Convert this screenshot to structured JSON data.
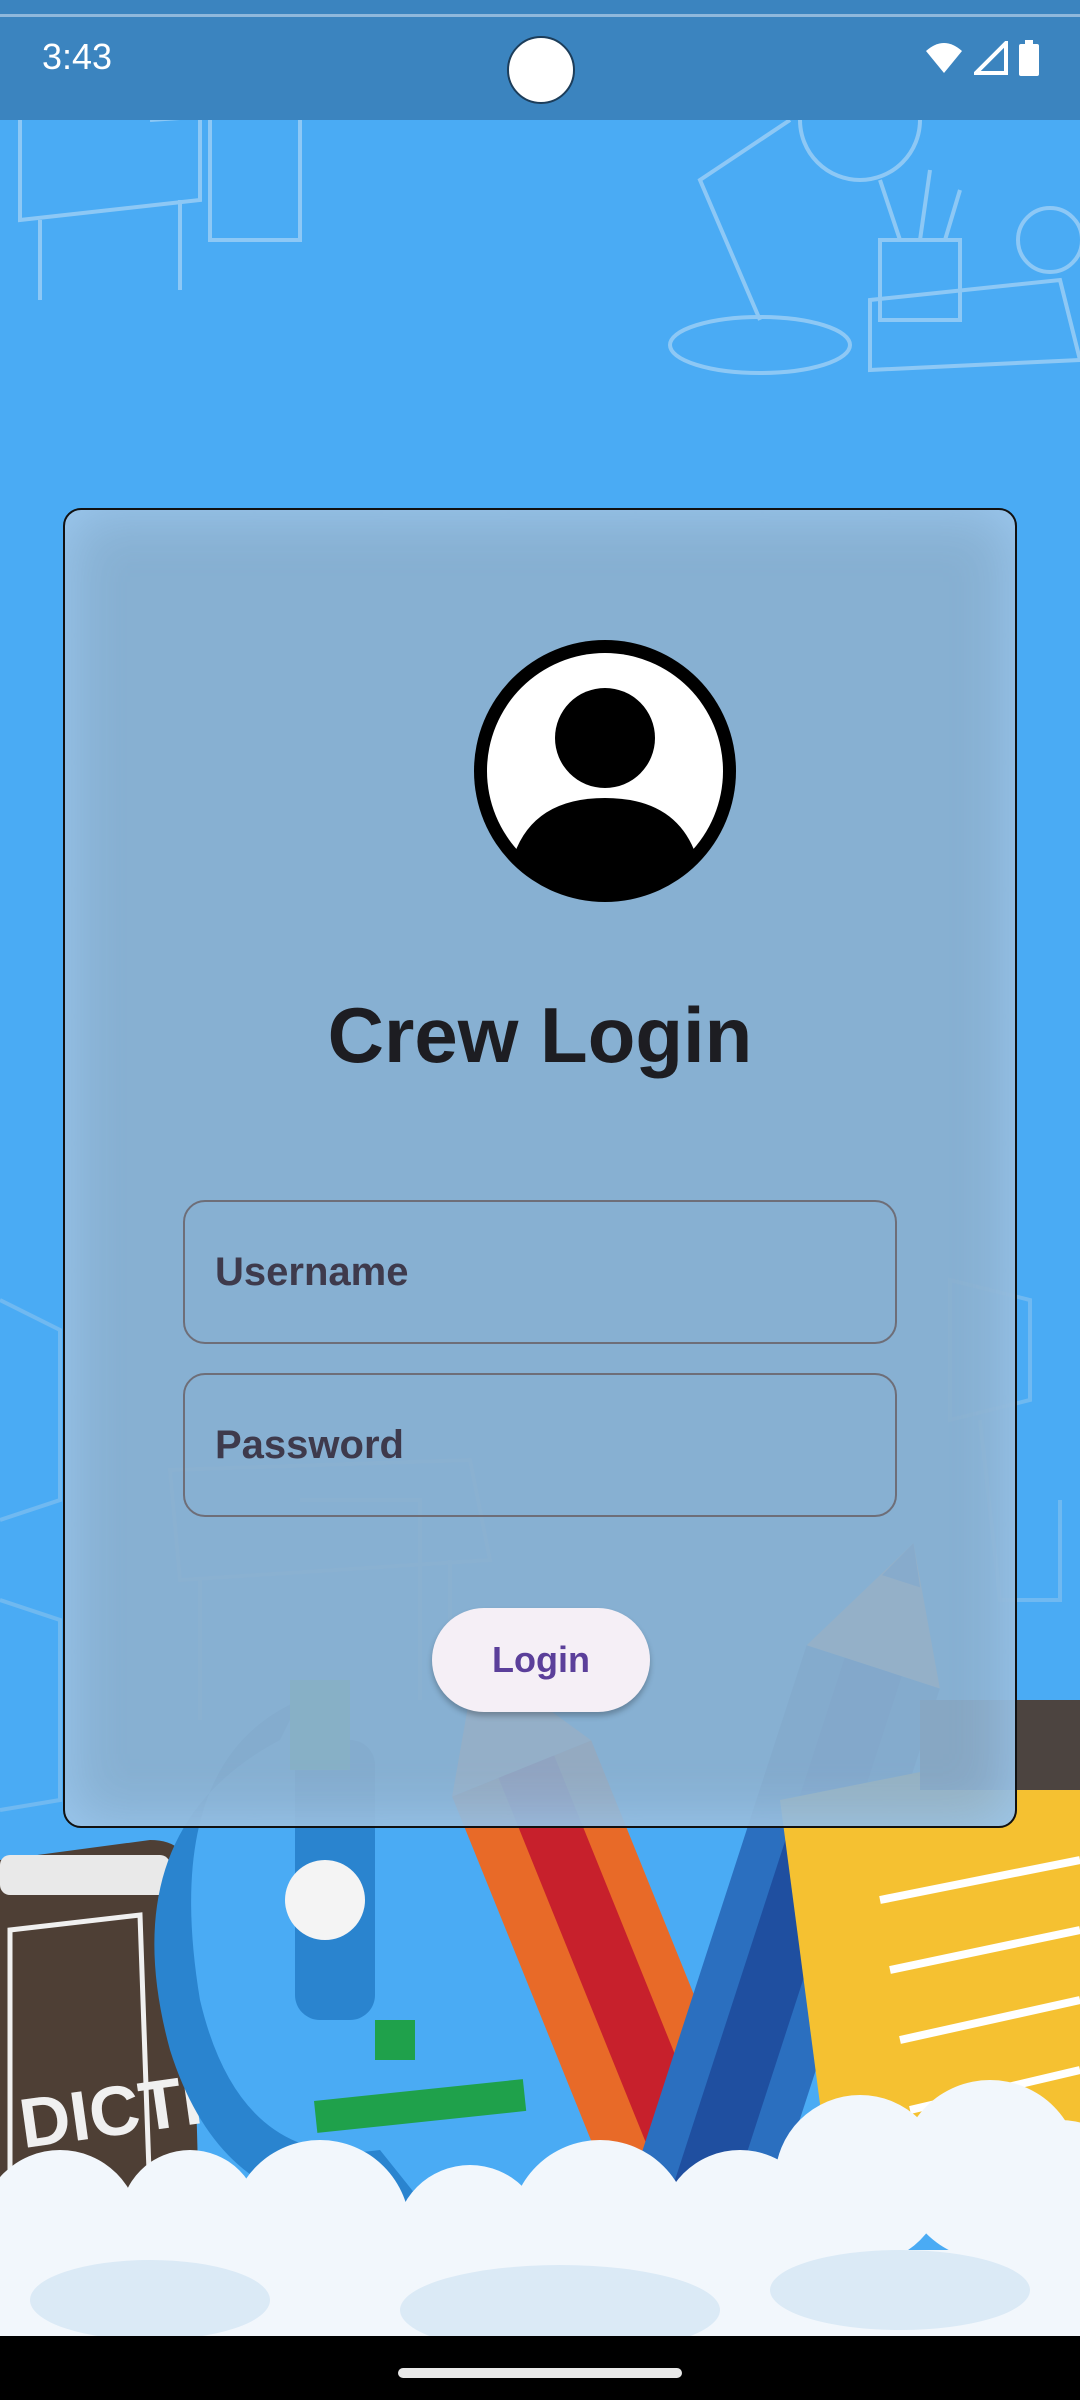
{
  "status_bar": {
    "time": "3:43",
    "icons": [
      "wifi-icon",
      "signal-icon",
      "battery-icon"
    ]
  },
  "login": {
    "title": "Crew Login",
    "avatar_icon": "account-circle-icon",
    "username_placeholder": "Username",
    "password_placeholder": "Password",
    "username_value": "",
    "password_value": "",
    "button_label": "Login"
  },
  "background": {
    "book_text": "DICTI"
  },
  "colors": {
    "background": "#4aabf4",
    "status_bar": "#3b84bf",
    "card": "#8cb0ce",
    "button_text": "#5b3f9a",
    "button_bg": "#f5eff6"
  }
}
